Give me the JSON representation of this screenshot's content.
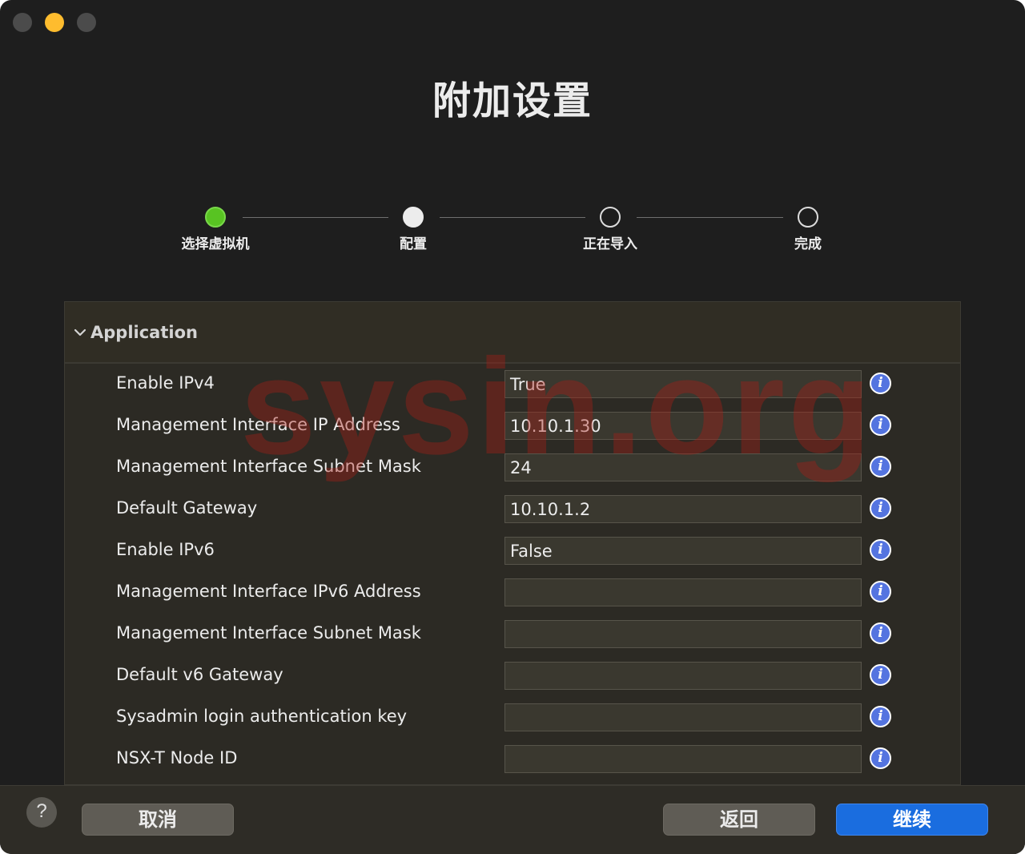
{
  "window": {
    "title": "附加设置"
  },
  "stepper": {
    "steps": [
      {
        "label": "选择虚拟机",
        "state": "done"
      },
      {
        "label": "配置",
        "state": "current"
      },
      {
        "label": "正在导入",
        "state": "pending"
      },
      {
        "label": "完成",
        "state": "pending"
      }
    ]
  },
  "section": {
    "title": "Application",
    "expanded": true,
    "rows": [
      {
        "label": "Enable IPv4",
        "value": "True"
      },
      {
        "label": "Management Interface IP Address",
        "value": "10.10.1.30"
      },
      {
        "label": "Management Interface Subnet Mask",
        "value": "24"
      },
      {
        "label": "Default Gateway",
        "value": "10.10.1.2"
      },
      {
        "label": "Enable IPv6",
        "value": "False"
      },
      {
        "label": "Management Interface IPv6 Address",
        "value": ""
      },
      {
        "label": "Management Interface Subnet Mask",
        "value": ""
      },
      {
        "label": "Default v6 Gateway",
        "value": ""
      },
      {
        "label": "Sysadmin login authentication key",
        "value": ""
      },
      {
        "label": "NSX-T Node ID",
        "value": ""
      }
    ],
    "info_glyph": "i"
  },
  "watermark": "sysin.org",
  "footer": {
    "help_label": "?",
    "cancel_label": "取消",
    "back_label": "返回",
    "continue_label": "继续"
  },
  "colors": {
    "accent": "#1a6ddf",
    "step_done": "#58c322",
    "info_icon": "#5474e0",
    "close_button": "#4b4b4b",
    "minimize_button": "#febc2e",
    "zoom_button": "#4b4b4b"
  }
}
